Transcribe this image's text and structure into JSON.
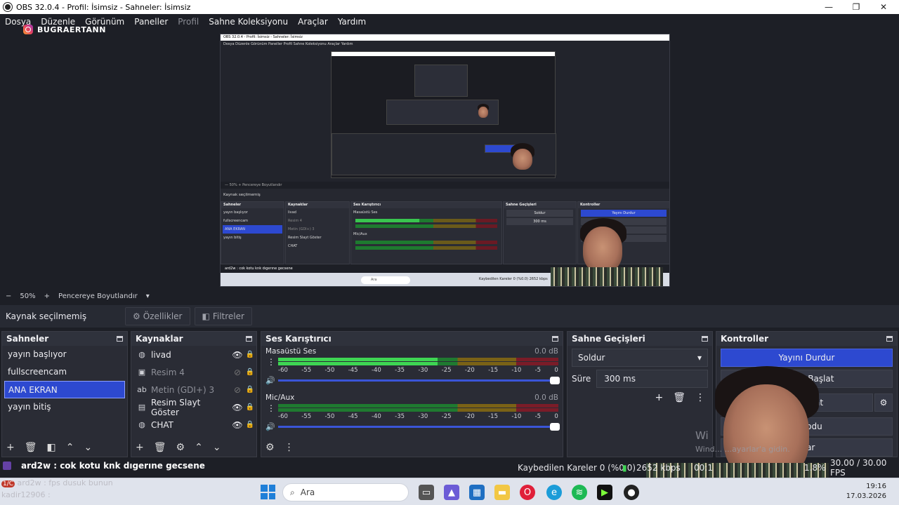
{
  "window": {
    "title": "OBS 32.0.4 - Profil: İsimsiz - Sahneler: İsimsiz",
    "minimize": "—",
    "maximize": "❐",
    "close": "✕"
  },
  "menu": [
    "Dosya",
    "Düzenle",
    "Görünüm",
    "Paneller",
    "Profil",
    "Sahne Koleksiyonu",
    "Araçlar",
    "Yardım"
  ],
  "overlay": {
    "streamer_name": "BUGRAERTANN",
    "chat_line1_user": "ard2w",
    "chat_line1_text": "ard2w : cok kotu knk dıgerıne gecsene",
    "chat_line2": "ard2w : fps dusuk bunun",
    "chat_line3": "kadir12906 :",
    "chat_badge": "1/C",
    "watermark_title": "Wi",
    "watermark_sub": "Wind... ...ayarlar'a gidin."
  },
  "preview": {
    "mini_title": "OBS 32.0.4 - Profil: İsimsiz - Sahneler: İsimsiz",
    "mini_menu": "Dosya  Düzenle  Görünüm  Paneller  Profil  Sahne Koleksiyonu  Araçlar  Yardım",
    "mini_zoom": "—   50%   +   Pencereye Boyutlandır",
    "mini_source": "Kaynak seçilmemiş",
    "mini_chat": "ard2w : cok kotu knk dıgerıne gecsene",
    "mini_search": "Ara",
    "mini_stats": "Kaybedilen Kareler 0 (%0.0)   2652 kbps",
    "mini_fps": "1.8%  30.00 / 30.00 FPS"
  },
  "zoom": {
    "minus": "−",
    "level": "50%",
    "plus": "+",
    "fit": "Pencereye Boyutlandır"
  },
  "sourcebar": {
    "label": "Kaynak seçilmemiş",
    "properties": "Özellikler",
    "filters": "Filtreler"
  },
  "scenes": {
    "title": "Sahneler",
    "items": [
      "yayın başlıyor",
      "fullscreencam",
      "ANA EKRAN",
      "yayın bitiş"
    ],
    "active_index": 2
  },
  "sources": {
    "title": "Kaynaklar",
    "items": [
      {
        "name": "livad",
        "icon": "globe-icon",
        "visible": true
      },
      {
        "name": "Resim 4",
        "icon": "image-icon",
        "visible": false
      },
      {
        "name": "Metin (GDI+) 3",
        "icon": "text-icon",
        "visible": false
      },
      {
        "name": "Resim Slayt Göster",
        "icon": "slideshow-icon",
        "visible": true
      },
      {
        "name": "CHAT",
        "icon": "globe-icon",
        "visible": true
      }
    ]
  },
  "mixer": {
    "title": "Ses Karıştırıcı",
    "ticks": [
      "-60",
      "-55",
      "-50",
      "-45",
      "-40",
      "-35",
      "-30",
      "-25",
      "-20",
      "-15",
      "-10",
      "-5",
      "0"
    ],
    "channels": [
      {
        "name": "Masaüstü Ses",
        "db": "0.0 dB",
        "level": 0.57
      },
      {
        "name": "Mic/Aux",
        "db": "0.0 dB",
        "level": 0.0
      }
    ]
  },
  "transitions": {
    "title": "Sahne Geçişleri",
    "selected": "Soldur",
    "duration_label": "Süre",
    "duration_value": "300 ms"
  },
  "controls": {
    "title": "Kontroller",
    "buttons": [
      "Yayını Durdur",
      "...aydı Başlat",
      "...rayı Başlat",
      "...Modu",
      "...ar"
    ]
  },
  "status": {
    "dropped": "Kaybedilen Kareler 0 (%0.0)",
    "bitrate": "2652 kbps",
    "time": "00:1",
    "cpu": "1.8%",
    "fps": "30.00 / 30.00 FPS"
  },
  "taskbar": {
    "search_placeholder": "Ara",
    "clock_time": "19:16",
    "clock_date": "17.03.2026"
  },
  "colors": {
    "accent": "#2d49d0",
    "background": "#1d1f26",
    "meter_green": "#3ed653"
  }
}
